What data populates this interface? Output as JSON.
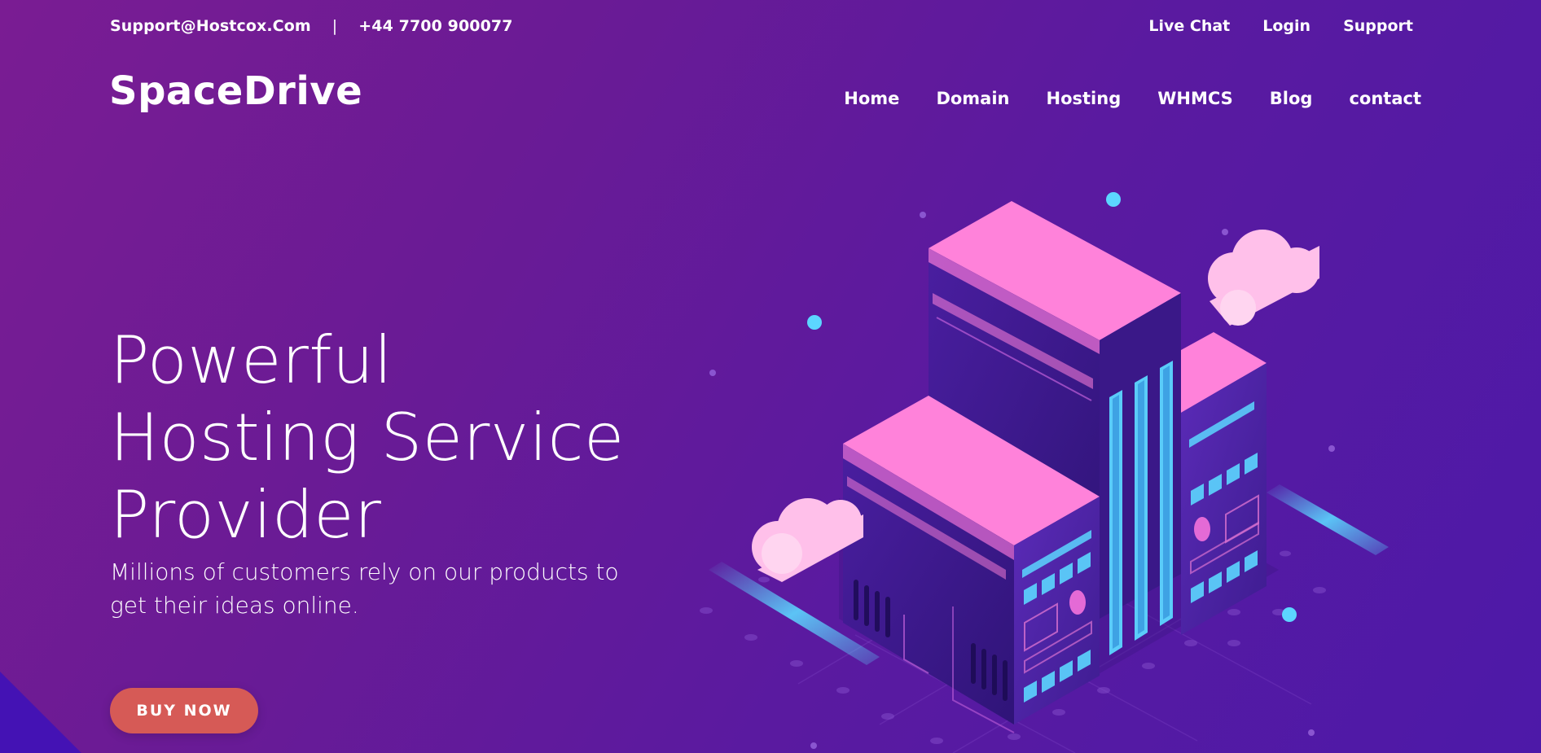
{
  "topbar": {
    "email": "Support@Hostcox.Com",
    "separator": "|",
    "phone": "+44 7700 900077",
    "links": [
      "Live Chat",
      "Login",
      "Support"
    ]
  },
  "header": {
    "logo": "SpaceDrive",
    "nav": [
      "Home",
      "Domain",
      "Hosting",
      "WHMCS",
      "Blog",
      "contact"
    ]
  },
  "hero": {
    "title_lines": [
      "Powerful",
      "Hosting Service",
      "Provider"
    ],
    "subtitle": "Millions of customers rely on our products to get their ideas online.",
    "cta": "BUY NOW"
  },
  "colors": {
    "accent": "#d65a56",
    "roof": "#ff82da",
    "glow": "#5cd6ff",
    "building": "#3b1a8a"
  }
}
